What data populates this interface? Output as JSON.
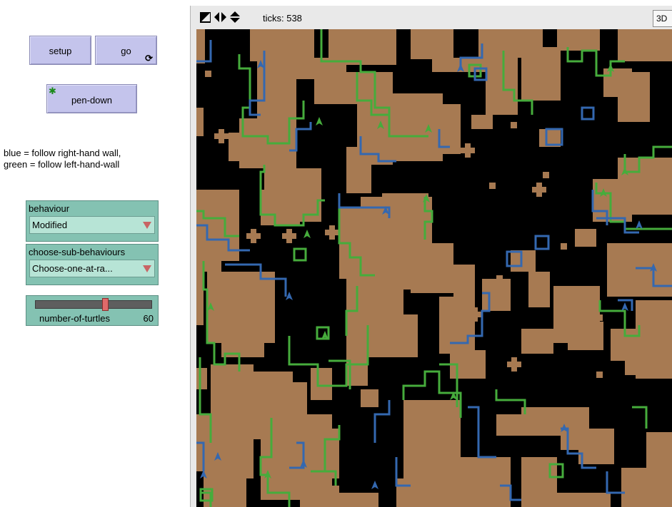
{
  "controls": {
    "setup_label": "setup",
    "go_label": "go",
    "pen_down_label": "pen-down",
    "note_line1": "blue = follow right-hand wall,",
    "note_line2": "green = follow left-hand-wall",
    "behaviour": {
      "label": "behaviour",
      "value": "Modified"
    },
    "sub_behaviours": {
      "label": "choose-sub-behaviours",
      "value": "Choose-one-at-ra..."
    },
    "slider": {
      "label": "number-of-turtles",
      "value": "60",
      "fraction": 0.6
    }
  },
  "toolbar": {
    "ticks_text": "ticks: 538",
    "three_d_label": "3D"
  },
  "colors": {
    "patch_brown": "#a77a52",
    "world_bg": "#000000",
    "right_hand_blue": "#3468b0",
    "left_hand_green": "#46ac3c",
    "button_fill": "#c4c4ec",
    "chooser_fill": "#84c2b2"
  }
}
